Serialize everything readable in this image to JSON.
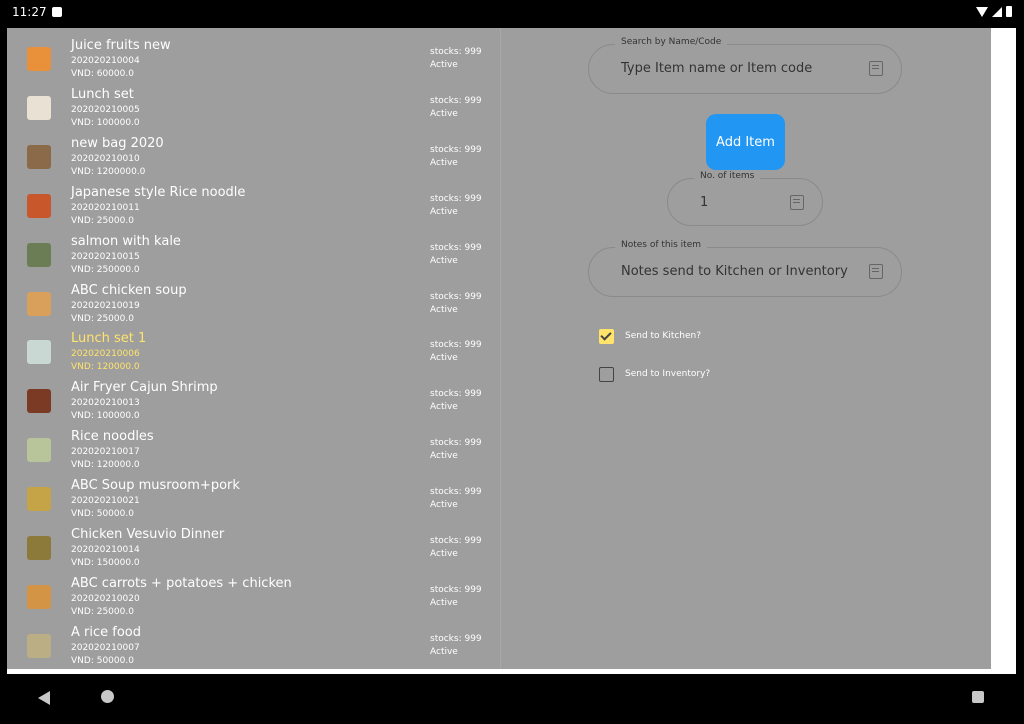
{
  "status_bar": {
    "time": "11:27"
  },
  "items": [
    {
      "name": "Juice fruits new",
      "code": "202020210004",
      "price": "VND: 60000.0",
      "stock": "stocks: 999",
      "status": "Active",
      "selected": false,
      "color": "#e8903a"
    },
    {
      "name": "Lunch set",
      "code": "202020210005",
      "price": "VND: 100000.0",
      "stock": "stocks: 999",
      "status": "Active",
      "selected": false,
      "color": "#e9e2d4"
    },
    {
      "name": "new bag 2020",
      "code": "202020210010",
      "price": "VND: 1200000.0",
      "stock": "stocks: 999",
      "status": "Active",
      "selected": false,
      "color": "#8a6a48"
    },
    {
      "name": "Japanese style Rice noodle",
      "code": "202020210011",
      "price": "VND: 25000.0",
      "stock": "stocks: 999",
      "status": "Active",
      "selected": false,
      "color": "#c9572c"
    },
    {
      "name": "salmon with kale",
      "code": "202020210015",
      "price": "VND: 250000.0",
      "stock": "stocks: 999",
      "status": "Active",
      "selected": false,
      "color": "#6b7d55"
    },
    {
      "name": "ABC chicken soup",
      "code": "202020210019",
      "price": "VND: 25000.0",
      "stock": "stocks: 999",
      "status": "Active",
      "selected": false,
      "color": "#d8a05a"
    },
    {
      "name": "Lunch set 1",
      "code": "202020210006",
      "price": "VND: 120000.0",
      "stock": "stocks: 999",
      "status": "Active",
      "selected": true,
      "color": "#c9d8d2"
    },
    {
      "name": "Air Fryer Cajun Shrimp",
      "code": "202020210013",
      "price": "VND: 100000.0",
      "stock": "stocks: 999",
      "status": "Active",
      "selected": false,
      "color": "#7a3a24"
    },
    {
      "name": "Rice noodles",
      "code": "202020210017",
      "price": "VND: 120000.0",
      "stock": "stocks: 999",
      "status": "Active",
      "selected": false,
      "color": "#b8c49a"
    },
    {
      "name": "ABC Soup musroom+pork",
      "code": "202020210021",
      "price": "VND: 50000.0",
      "stock": "stocks: 999",
      "status": "Active",
      "selected": false,
      "color": "#c4a447"
    },
    {
      "name": "Chicken Vesuvio Dinner",
      "code": "202020210014",
      "price": "VND: 150000.0",
      "stock": "stocks: 999",
      "status": "Active",
      "selected": false,
      "color": "#8c7a3a"
    },
    {
      "name": "ABC carrots + potatoes + chicken",
      "code": "202020210020",
      "price": "VND: 25000.0",
      "stock": "stocks: 999",
      "status": "Active",
      "selected": false,
      "color": "#d49446"
    },
    {
      "name": "A rice food",
      "code": "202020210007",
      "price": "VND: 50000.0",
      "stock": "stocks: 999",
      "status": "Active",
      "selected": false,
      "color": "#bcae84"
    }
  ],
  "search": {
    "label": "Search by Name/Code",
    "placeholder": "Type Item name or Item code"
  },
  "add_button": {
    "label": "Add Item"
  },
  "quantity": {
    "label": "No. of items",
    "value": "1"
  },
  "notes": {
    "label": "Notes of this item",
    "placeholder": "Notes send to Kitchen or Inventory"
  },
  "options": {
    "kitchen": {
      "label": "Send to Kitchen?",
      "checked": true
    },
    "inventory": {
      "label": "Send to Inventory?",
      "checked": false
    }
  },
  "colors": {
    "accent": "#2196f3",
    "highlight": "#ffe36b",
    "overlay": "#9e9e9e"
  }
}
